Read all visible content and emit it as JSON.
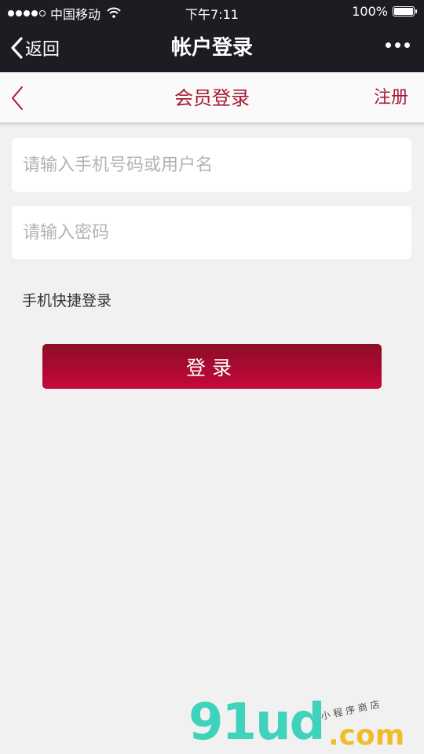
{
  "status_bar": {
    "carrier": "中国移动",
    "time": "下午7:11",
    "battery": "100%",
    "battery_level": 1.0
  },
  "wechat_nav": {
    "back_label": "返回",
    "title": "帐户登录"
  },
  "header": {
    "title": "会员登录",
    "register_label": "注册"
  },
  "form": {
    "username_placeholder": "请输入手机号码或用户名",
    "username_value": "",
    "password_placeholder": "请输入密码",
    "password_value": "",
    "quick_login_label": "手机快捷登录",
    "login_button_label": "登录"
  },
  "watermark": {
    "main": "91ud",
    "suffix": ".com",
    "tagline": "小程序商店"
  },
  "colors": {
    "accent": "#a61a36",
    "button_top": "#8e0c26",
    "button_bottom": "#c5093a",
    "nav_bg": "#1d1c22"
  },
  "icons": [
    "signal-icon",
    "wifi-icon",
    "battery-icon",
    "back-chevron-icon",
    "more-icon"
  ]
}
